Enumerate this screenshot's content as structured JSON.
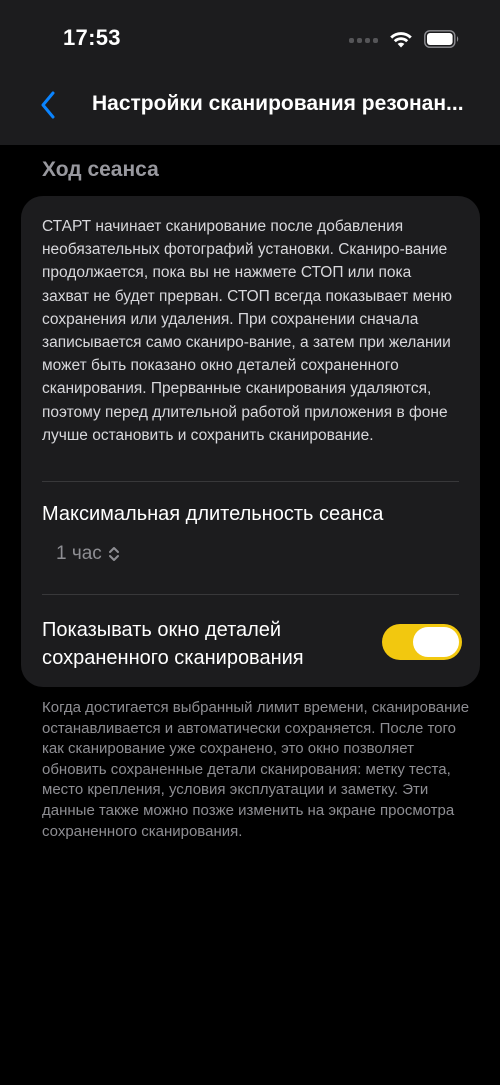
{
  "status_bar": {
    "time": "17:53"
  },
  "nav": {
    "title": "Настройки сканирования резонан...",
    "back_icon": "chevron-left-icon"
  },
  "section": {
    "header": "Ход сеанса"
  },
  "card": {
    "description": "СТАРТ начинает сканирование после добавления необязательных фотографий установки. Сканиро-вание продолжается, пока вы не нажмете СТОП или пока захват не будет прерван. СТОП всегда показывает меню сохранения или удаления. При сохранении сначала записывается само сканиро-вание, а затем при желании может быть показано окно деталей сохраненного сканирования. Прерванные сканирования удаляются, поэтому перед длительной работой приложения в фоне лучше остановить и сохранить сканирование.",
    "max_duration_label": "Максимальная длительность сеанса",
    "max_duration_value": "1 час",
    "toggle_label": "Показывать окно деталей сохраненного сканирования",
    "toggle_on": true
  },
  "footer": {
    "note": "Когда достигается выбранный лимит времени, сканирование останавливается и автоматически сохраняется. После того как сканирование уже сохранено, это окно позволяет обновить сохраненные детали сканирования: метку теста, место крепления, условия эксплуатации и заметку. Эти данные также можно позже изменить на экране просмотра сохраненного сканирования."
  },
  "colors": {
    "accent_blue": "#0a84ff",
    "toggle_on": "#f2c80f",
    "card_bg": "#1c1c1e",
    "background": "#000000"
  }
}
